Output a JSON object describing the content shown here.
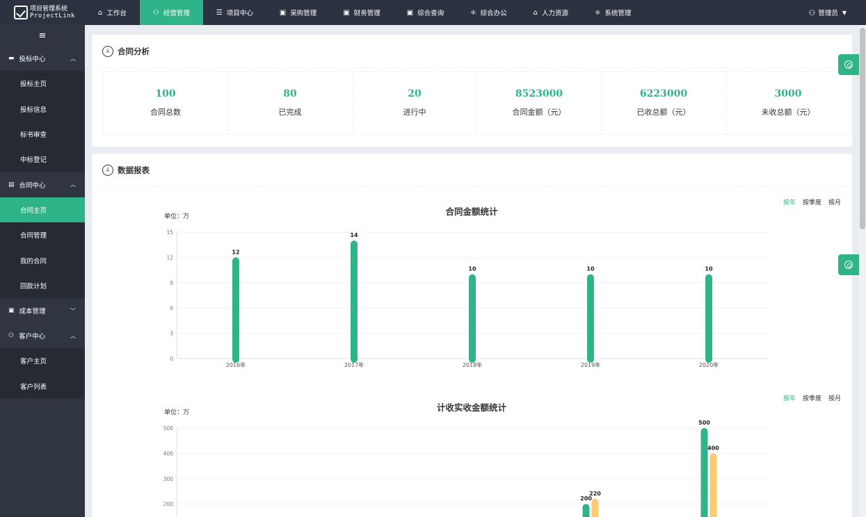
{
  "app": {
    "logo_line1": "项目管理系统",
    "logo_line2": "ProjectLink"
  },
  "nav": [
    {
      "label": "工作台",
      "icon": "home-icon",
      "active": false
    },
    {
      "label": "经营管理",
      "icon": "user-gear-icon",
      "active": true
    },
    {
      "label": "项目中心",
      "icon": "list-icon",
      "active": false
    },
    {
      "label": "采购管理",
      "icon": "box-icon",
      "active": false
    },
    {
      "label": "财务管理",
      "icon": "box-icon",
      "active": false
    },
    {
      "label": "综合查询",
      "icon": "box-icon",
      "active": false
    },
    {
      "label": "综合办公",
      "icon": "sliders-icon",
      "active": false
    },
    {
      "label": "人力资源",
      "icon": "home-icon",
      "active": false
    },
    {
      "label": "系统管理",
      "icon": "sliders-icon",
      "active": false
    }
  ],
  "user": {
    "name": "管理员"
  },
  "sidebar": {
    "groups": [
      {
        "title": "投标中心",
        "icon": "briefcase-icon",
        "expanded": true,
        "items": [
          "投标主页",
          "投标信息",
          "标书审查",
          "中标登记"
        ]
      },
      {
        "title": "合同中心",
        "icon": "contract-icon",
        "expanded": true,
        "items": [
          "合同主页",
          "合同管理",
          "我的合同",
          "回款计划"
        ],
        "active_item": "合同主页"
      },
      {
        "title": "成本管理",
        "icon": "box-icon",
        "expanded": false,
        "items": []
      },
      {
        "title": "客户中心",
        "icon": "user-gear-icon",
        "expanded": true,
        "items": [
          "客户主页",
          "客户列表"
        ]
      }
    ]
  },
  "analysis": {
    "title": "合同分析",
    "stats": [
      {
        "value": "100",
        "label": "合同总数"
      },
      {
        "value": "80",
        "label": "已完成"
      },
      {
        "value": "20",
        "label": "进行中"
      },
      {
        "value": "8523000",
        "label": "合同金额（元）"
      },
      {
        "value": "6223000",
        "label": "已收总额（元）"
      },
      {
        "value": "3000",
        "label": "未收总额（元）"
      }
    ]
  },
  "report": {
    "title": "数据报表",
    "periods": [
      "按年",
      "按季度",
      "按月"
    ],
    "active_period": "按年",
    "accent": "#2fb48a",
    "secondary": "#fdcb6e"
  },
  "chart_data": [
    {
      "type": "bar",
      "title": "合同金额统计",
      "unit_label": "单位：万",
      "categories": [
        "2016年",
        "2017年",
        "2018年",
        "2019年",
        "2020年"
      ],
      "values": [
        12,
        14,
        10,
        10,
        10
      ],
      "ylim": [
        0,
        15
      ],
      "yticks": [
        0,
        3,
        6,
        9,
        12,
        15
      ],
      "grid": true,
      "color": "#2fb48a"
    },
    {
      "type": "bar",
      "title": "计收实收金额统计",
      "unit_label": "单位：万",
      "categories": [
        "",
        "",
        "",
        "",
        ""
      ],
      "series": [
        {
          "values": [
            0,
            0,
            0,
            200,
            500
          ],
          "color": "#2fb48a"
        },
        {
          "values": [
            0,
            0,
            0,
            220,
            400
          ],
          "color": "#fdcb6e"
        }
      ],
      "ylim": [
        0,
        500
      ],
      "yticks": [
        200,
        300,
        400,
        500
      ],
      "grid": true
    }
  ]
}
